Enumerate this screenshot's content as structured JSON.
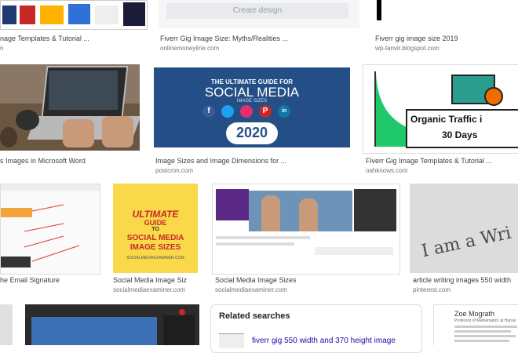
{
  "row1": [
    {
      "caption": "nage Templates & Tutorial ...",
      "source": "n"
    },
    {
      "caption": "Fiverr Gig Image Size: Myths/Realities ...",
      "source": "onlinemoneyline.com",
      "button": "Create design"
    },
    {
      "caption": "Fiverr gig image size 2019",
      "source": "wp-tanvir.blogspot.com"
    }
  ],
  "row2": [
    {
      "caption": "s Images in Microsoft Word",
      "source": ""
    },
    {
      "caption": "Image Sizes and Image Dimensions for ...",
      "source": "postcron.com",
      "thumb": {
        "line1": "THE ULTIMATE GUIDE FOR",
        "line2": "SOCIAL MEDIA",
        "line3": "IMAGE SIZES",
        "year": "2020"
      }
    },
    {
      "caption": "Fiverr Gig Image Templates & Tutorial ...",
      "source": "oahknows.com",
      "thumb": {
        "line1": "Organic Traffic i",
        "line2": "30 Days"
      }
    }
  ],
  "row3": [
    {
      "caption": "he Email Signature",
      "source": ""
    },
    {
      "caption": "Social Media Image Siz",
      "source": "socialmediaexaminer.com",
      "thumb": {
        "line1": "ULTIMATE",
        "line2": "GUIDE",
        "line3": "TO",
        "line4": "SOCIAL MEDIA",
        "line5": "IMAGE SIZES",
        "line6": "SOCIALMEDIAEXAMINER.COM"
      }
    },
    {
      "caption": "Social Media Image Sizes",
      "source": "socialmediaexaminer.com"
    },
    {
      "caption": "article writing images 550 width",
      "source": "pinterest.com",
      "thumb": {
        "text": "I am a Wri"
      }
    }
  ],
  "related": {
    "heading": "Related searches",
    "item": "fiverr gig 550 width and 370 height image"
  },
  "row4": {
    "name": "Zoe Mograth",
    "title": "Professor of Mathematics at Harvar"
  }
}
